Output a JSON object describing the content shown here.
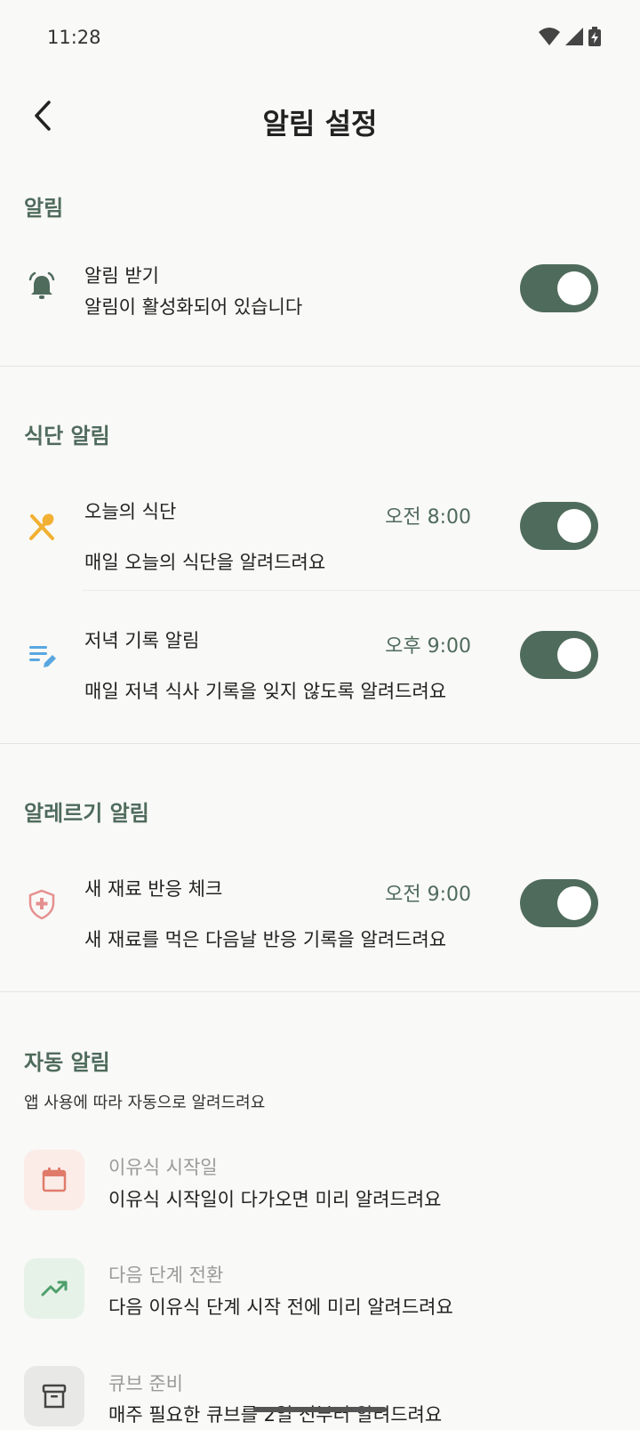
{
  "status_bar": {
    "time": "11:28"
  },
  "header": {
    "title": "알림 설정"
  },
  "sections": {
    "notifications": {
      "title": "알림",
      "receive": {
        "title": "알림 받기",
        "desc": "알림이 활성화되어 있습니다",
        "enabled": true
      }
    },
    "meal": {
      "title": "식단 알림",
      "today": {
        "title": "오늘의 식단",
        "time": "오전 8:00",
        "desc": "매일 오늘의 식단을 알려드려요",
        "enabled": true
      },
      "dinner": {
        "title": "저녁 기록 알림",
        "time": "오후 9:00",
        "desc": "매일 저녁 식사 기록을 잊지 않도록 알려드려요",
        "enabled": true
      }
    },
    "allergy": {
      "title": "알레르기 알림",
      "new_ingredient": {
        "title": "새 재료 반응 체크",
        "time": "오전 9:00",
        "desc": "새 재료를 먹은 다음날 반응 기록을 알려드려요",
        "enabled": true
      }
    },
    "auto": {
      "title": "자동 알림",
      "subtitle": "앱 사용에 따라 자동으로 알려드려요",
      "items": [
        {
          "title": "이유식 시작일",
          "desc": "이유식 시작일이 다가오면 미리 알려드려요",
          "icon": "calendar-icon",
          "bg": "#fbece8",
          "color": "#e07b6a"
        },
        {
          "title": "다음 단계 전환",
          "desc": "다음 이유식 단계 시작 전에 미리 알려드려요",
          "icon": "trending-up-icon",
          "bg": "#e6f2e8",
          "color": "#4e9e6c"
        },
        {
          "title": "큐브 준비",
          "desc": "매주 필요한 큐브를 2일 전부터 알려드려요",
          "icon": "archive-box-icon",
          "bg": "#e8e8e6",
          "color": "#444444"
        }
      ]
    }
  },
  "colors": {
    "accent": "#4f6b5c",
    "background": "#f9f9f7",
    "meal_icon": "#f2b032",
    "edit_icon": "#5aa7e0",
    "allergy_icon": "#e59090"
  }
}
